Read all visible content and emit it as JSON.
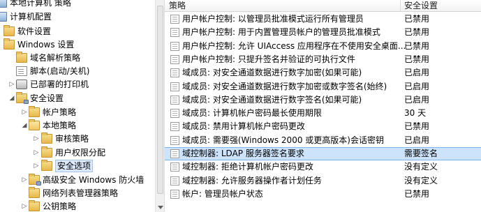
{
  "tree": {
    "items": [
      {
        "label": "本地计算机 策略",
        "level": 0,
        "toggle": "",
        "icon": "computer-icon"
      },
      {
        "label": "计算机配置",
        "level": 0,
        "toggle": "open",
        "icon": "computer-icon"
      },
      {
        "label": "软件设置",
        "level": 1,
        "toggle": "closed",
        "icon": "folder-icon"
      },
      {
        "label": "Windows 设置",
        "level": 1,
        "toggle": "open",
        "icon": "folder-icon"
      },
      {
        "label": "域名解析策略",
        "level": 2,
        "toggle": "",
        "icon": "folder-icon"
      },
      {
        "label": "脚本(启动/关机)",
        "level": 2,
        "toggle": "",
        "icon": "script-icon"
      },
      {
        "label": "已部署的打印机",
        "level": 2,
        "toggle": "closed",
        "icon": "printer-icon"
      },
      {
        "label": "安全设置",
        "level": 2,
        "toggle": "open",
        "icon": "security-folder-icon"
      },
      {
        "label": "帐户策略",
        "level": 3,
        "toggle": "closed",
        "icon": "folder-icon"
      },
      {
        "label": "本地策略",
        "level": 3,
        "toggle": "open",
        "icon": "folder-open-icon"
      },
      {
        "label": "审核策略",
        "level": 4,
        "toggle": "closed",
        "icon": "folder-icon"
      },
      {
        "label": "用户权限分配",
        "level": 4,
        "toggle": "closed",
        "icon": "folder-icon"
      },
      {
        "label": "安全选项",
        "level": 4,
        "toggle": "closed",
        "icon": "folder-icon",
        "selected": true
      },
      {
        "label": "高级安全 Windows 防火墙",
        "level": 3,
        "toggle": "closed",
        "icon": "security-folder-icon"
      },
      {
        "label": "网络列表管理器策略",
        "level": 3,
        "toggle": "",
        "icon": "folder-icon"
      },
      {
        "label": "公钥策略",
        "level": 3,
        "toggle": "closed",
        "icon": "folder-icon"
      }
    ]
  },
  "list": {
    "columns": {
      "policy": "策略",
      "setting": "安全设置"
    },
    "rows": [
      {
        "policy": "用户帐户控制: 以管理员批准模式运行所有管理员",
        "setting": "已禁用"
      },
      {
        "policy": "用户帐户控制: 用于内置管理员帐户的管理员批准模式",
        "setting": "已禁用"
      },
      {
        "policy": "用户帐户控制: 允许 UIAccess 应用程序在不使用安全桌面...",
        "setting": "已禁用"
      },
      {
        "policy": "用户帐户控制: 只提升签名并验证的可执行文件",
        "setting": "已禁用"
      },
      {
        "policy": "域成员: 对安全通道数据进行数字加密(如果可能)",
        "setting": "已启用"
      },
      {
        "policy": "域成员: 对安全通道数据进行数字加密或数字签名(始终)",
        "setting": "已启用"
      },
      {
        "policy": "域成员: 对安全通道数据进行数字签名(如果可能)",
        "setting": "已启用"
      },
      {
        "policy": "域成员: 计算机帐户密码最长使用期限",
        "setting": "30 天"
      },
      {
        "policy": "域成员: 禁用计算机帐户密码更改",
        "setting": "已禁用"
      },
      {
        "policy": "域成员: 需要强(Windows 2000 或更高版本)会话密钥",
        "setting": "已启用"
      },
      {
        "policy": "域控制器: LDAP 服务器签名要求",
        "setting": "需要签名",
        "selected": true
      },
      {
        "policy": "域控制器: 拒绝计算机帐户密码更改",
        "setting": "没有定义"
      },
      {
        "policy": "域控制器: 允许服务器操作者计划任务",
        "setting": "没有定义"
      },
      {
        "policy": "帐户: 管理员帐户状态",
        "setting": "已禁用"
      }
    ]
  }
}
